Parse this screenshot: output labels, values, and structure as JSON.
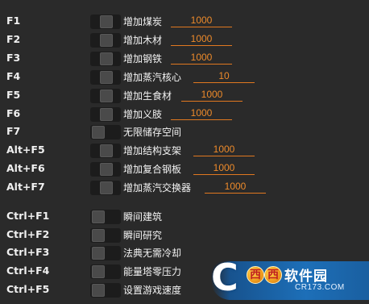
{
  "rows": [
    {
      "key": "F1",
      "label": "增加煤炭",
      "value": "1000"
    },
    {
      "key": "F2",
      "label": "增加木材",
      "value": "1000"
    },
    {
      "key": "F3",
      "label": "增加钢铁",
      "value": "1000"
    },
    {
      "key": "F4",
      "label": "增加蒸汽核心",
      "value": "10"
    },
    {
      "key": "F5",
      "label": "增加生食材",
      "value": "1000"
    },
    {
      "key": "F6",
      "label": "增加义肢",
      "value": "1000"
    },
    {
      "key": "F7",
      "label": "无限储存空间"
    },
    {
      "key": "Alt+F5",
      "label": "增加结构支架",
      "value": "1000"
    },
    {
      "key": "Alt+F6",
      "label": "增加复合钢板",
      "value": "1000"
    },
    {
      "key": "Alt+F7",
      "label": "增加蒸汽交换器",
      "value": "1000"
    },
    {
      "key": "Ctrl+F1",
      "label": "瞬间建筑"
    },
    {
      "key": "Ctrl+F2",
      "label": "瞬间研究"
    },
    {
      "key": "Ctrl+F3",
      "label": "法典无需冷却"
    },
    {
      "key": "Ctrl+F4",
      "label": "能量塔零压力"
    },
    {
      "key": "Ctrl+F5",
      "label": "设置游戏速度"
    }
  ],
  "watermark": {
    "letter": "C",
    "ball1": "西",
    "ball2": "西",
    "title": "软件园",
    "url": "CR173.COM"
  },
  "colors": {
    "background": "#2a2a2a",
    "accent": "#e07820"
  }
}
